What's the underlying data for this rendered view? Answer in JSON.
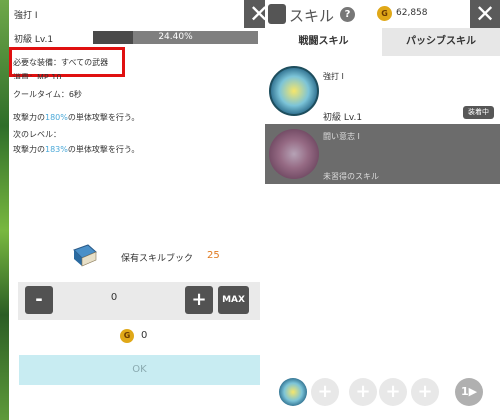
{
  "detail": {
    "skill_name": "強打 I",
    "level_label": "初級 Lv.1",
    "progress_text": "24.40%",
    "progress_value": 24.4,
    "required_equipment": "必要な装備：すべての武器",
    "mp_cost": "消費：MP 10",
    "cooldown": "クールタイム：6秒",
    "current_desc": {
      "before": "攻撃力の",
      "pct": "180%",
      "after": "の単体攻撃を行う。"
    },
    "next_level_label": "次のレベル：",
    "next_desc": {
      "before": "攻撃力の",
      "pct": "183%",
      "after": "の単体攻撃を行う。"
    },
    "book_label": "保有スキルブック",
    "book_count": "25",
    "quantity": "0",
    "minus_label": "-",
    "plus_label": "+",
    "max_label": "MAX",
    "cost_coin_label": "G",
    "cost_value": "0",
    "ok_label": "OK",
    "close_label": "✕"
  },
  "right": {
    "title": "スキル",
    "help_label": "?",
    "gold_coin_label": "G",
    "gold_amount": "62,858",
    "close_label": "✕",
    "tabs": [
      {
        "label": "戦闘スキル",
        "active": true
      },
      {
        "label": "パッシブスキル",
        "active": false
      }
    ],
    "skills": [
      {
        "name": "強打 I",
        "level": "初級 Lv.1",
        "badge": "装着中"
      },
      {
        "name": "闘い意志 I",
        "status": "未習得のスキル"
      }
    ],
    "slots": [
      "+",
      "+",
      "+",
      "+"
    ],
    "next_label": "1▶"
  },
  "colors": {
    "highlight": "#4aa8d8",
    "book_count": "#e07a20",
    "ok_bg": "#c8ecf2",
    "panel_dark": "#5a5a5a"
  }
}
